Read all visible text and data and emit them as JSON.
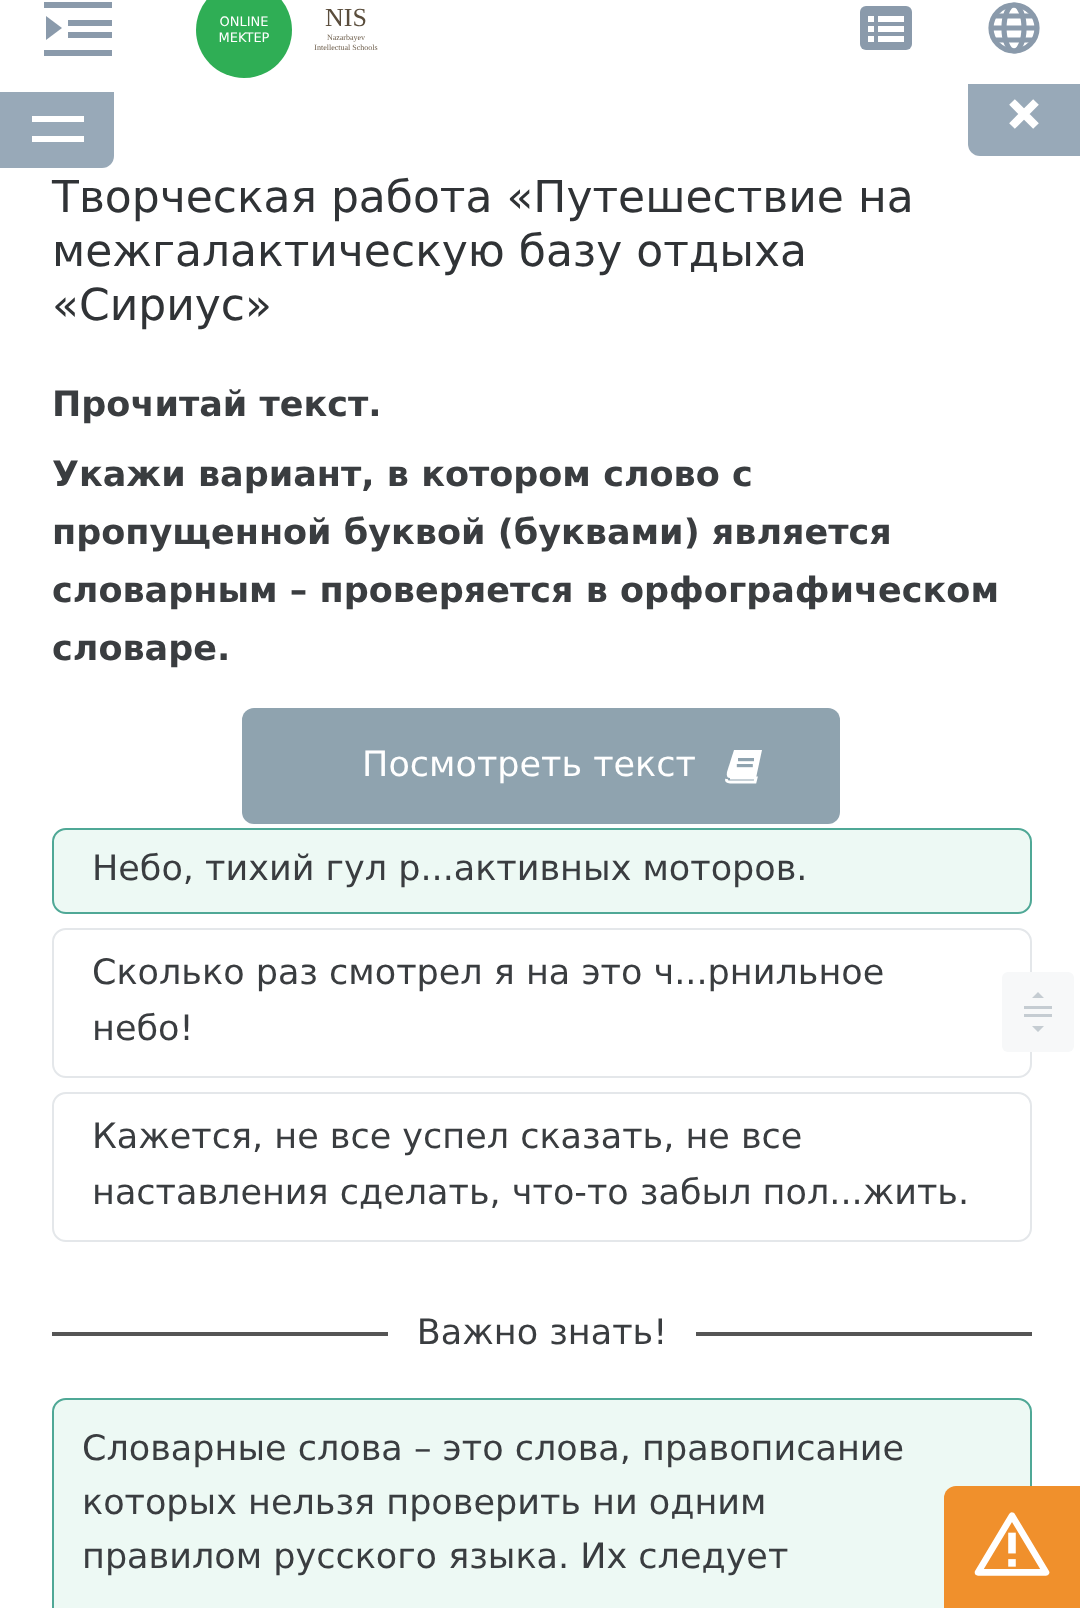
{
  "header": {
    "logo_text": "ONLINE MEKTEP",
    "partner_logo": {
      "name": "NIS",
      "subtitle": "Nazarbayev Intellectual Schools"
    }
  },
  "title": "Творческая работа «Путешествие на межгалактическую базу отдыха «Сириус»",
  "instructions": [
    "Прочитай текст.",
    "Укажи вариант, в котором слово с пропущенной буквой (буквами) является словарным – проверяется в орфографическом словаре."
  ],
  "view_text_button": "Посмотреть текст",
  "options": [
    {
      "text": "Небо, тихий гул р...активных моторов.",
      "selected": true
    },
    {
      "text": "Сколько раз смотрел я на это ч...рнильное небо!",
      "selected": false
    },
    {
      "text": "Кажется, не все успел сказать, не все наставления сделать, что-то забыл пол...жить.",
      "selected": false
    }
  ],
  "divider_label": "Важно знать!",
  "info": "Словарные слова – это слова, правописание которых нельзя проверить ни одним правилом русского языка. Их следует"
}
